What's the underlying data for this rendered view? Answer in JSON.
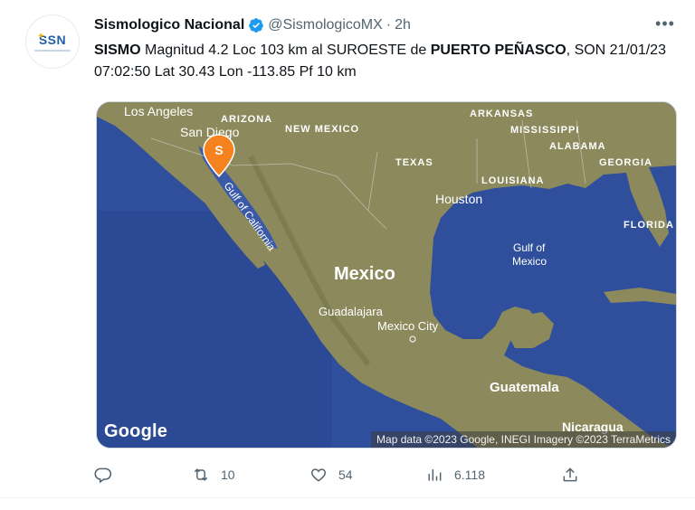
{
  "account": {
    "name": "Sismologico Nacional",
    "handle": "@SismologicoMX",
    "separator": "·",
    "time": "2h",
    "avatar_text": "SSN"
  },
  "tweet": {
    "bold_lead": "SISMO",
    "text_1": " Magnitud 4.2 Loc  103 km al SUROESTE de ",
    "bold_place": "PUERTO PEÑASCO",
    "text_2": ", SON 21/01/23 07:02:50 Lat 30.43 Lon -113.85 Pf 10 km"
  },
  "map": {
    "labels": {
      "los_angeles": "Los Angeles",
      "arizona": "ARIZONA",
      "new_mexico": "NEW MEXICO",
      "san_diego": "San Diego",
      "arkansas": "ARKANSAS",
      "mississippi": "MISSISSIPPI",
      "alabama": "ALABAMA",
      "georgia": "GEORGIA",
      "texas": "TEXAS",
      "louisiana": "LOUISIANA",
      "houston": "Houston",
      "florida": "FLORIDA",
      "gulf_of_mexico_1": "Gulf of",
      "gulf_of_mexico_2": "Mexico",
      "gulf_of_california": "Gulf of California",
      "mexico": "Mexico",
      "guadalajara": "Guadalajara",
      "mexico_city": "Mexico City",
      "guatemala": "Guatemala",
      "nicaragua": "Nicaragua",
      "marker": "S"
    },
    "google": "Google",
    "attribution": "Map data ©2023 Google, INEGI Imagery ©2023 TerraMetrics",
    "colors": {
      "ocean": "#2f4f9c",
      "land": "#8a8a5a",
      "marker": "#f5821f"
    }
  },
  "actions": {
    "reply_count": "",
    "retweet_count": "10",
    "like_count": "54",
    "views_count": "6.118"
  },
  "icons": {
    "reply": "reply-icon",
    "retweet": "retweet-icon",
    "like": "like-icon",
    "views": "views-icon",
    "share": "share-icon",
    "verified": "verified-icon",
    "more": "more-icon"
  }
}
